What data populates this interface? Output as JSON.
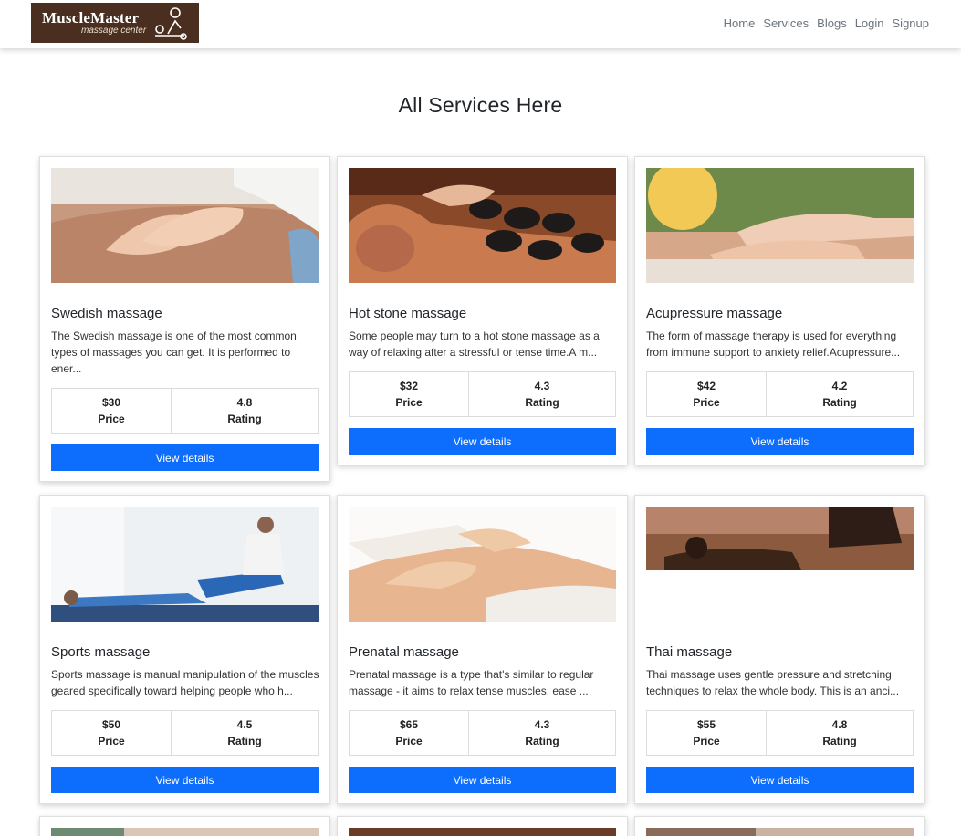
{
  "brand": {
    "name": "MuscleMaster",
    "tagline": "massage center"
  },
  "nav": [
    "Home",
    "Services",
    "Blogs",
    "Login",
    "Signup"
  ],
  "page_title": "All Services Here",
  "labels": {
    "price": "Price",
    "rating": "Rating",
    "button": "View details"
  },
  "services": [
    {
      "name": "Swedish massage",
      "description": "The Swedish massage is one of the most common types of massages you can get. It is performed to ener...",
      "price": "$30",
      "rating": "4.8"
    },
    {
      "name": "Hot stone massage",
      "description": "Some people may turn to a hot stone massage as a way of relaxing after a stressful or tense time.A m...",
      "price": "$32",
      "rating": "4.3"
    },
    {
      "name": "Acupressure massage",
      "description": "The form of massage therapy is used for everything from immune support to anxiety relief.Acupressure...",
      "price": "$42",
      "rating": "4.2"
    },
    {
      "name": "Sports massage",
      "description": "Sports massage is manual manipulation of the muscles geared specifically toward helping people who h...",
      "price": "$50",
      "rating": "4.5"
    },
    {
      "name": "Prenatal massage",
      "description": "Prenatal massage is a type that's similar to regular massage - it aims to relax tense muscles, ease ...",
      "price": "$65",
      "rating": "4.3"
    },
    {
      "name": "Thai massage",
      "description": "Thai massage uses gentle pressure and stretching techniques to relax the whole body. This is an anci...",
      "price": "$55",
      "rating": "4.8"
    }
  ],
  "colors": {
    "brand_bg": "#4a2e1f",
    "button": "#0d6efd"
  }
}
